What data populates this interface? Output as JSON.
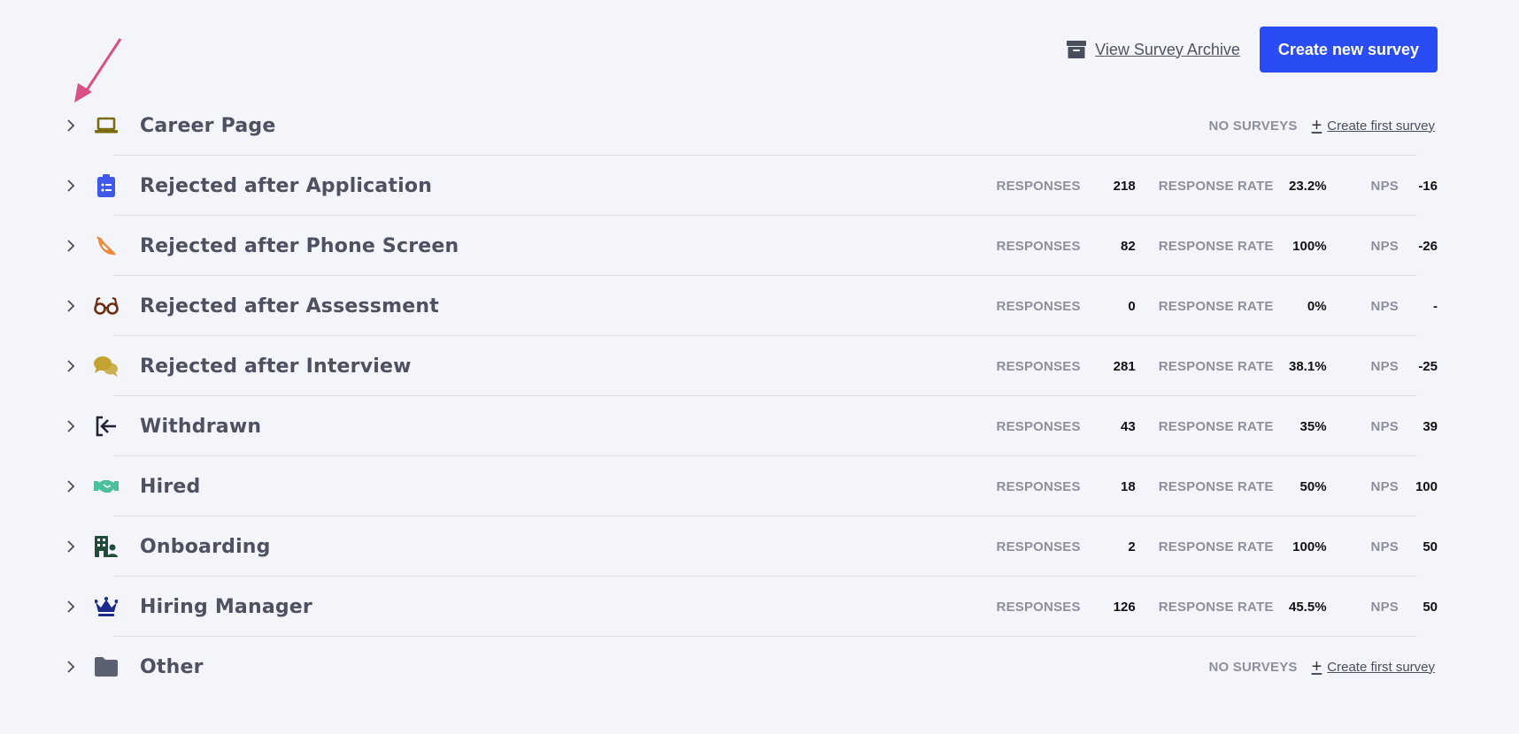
{
  "header": {
    "archive_label": "View Survey Archive",
    "create_label": "Create new survey"
  },
  "labels": {
    "responses": "RESPONSES",
    "response_rate": "RESPONSE RATE",
    "nps": "NPS",
    "no_surveys": "NO SURVEYS",
    "create_first": "Create first survey"
  },
  "colors": {
    "accent": "#2a4cf5",
    "annotation_arrow": "#d94f86"
  },
  "categories": [
    {
      "title": "Career Page",
      "icon": "laptop-icon",
      "icon_color": "#7a6a10",
      "has_surveys": false
    },
    {
      "title": "Rejected after Application",
      "icon": "clipboard-list-icon",
      "icon_color": "#3f5ae8",
      "has_surveys": true,
      "responses": "218",
      "response_rate": "23.2%",
      "nps": "-16"
    },
    {
      "title": "Rejected after Phone Screen",
      "icon": "phone-slash-icon",
      "icon_color": "#ee8a3e",
      "has_surveys": true,
      "responses": "82",
      "response_rate": "100%",
      "nps": "-26"
    },
    {
      "title": "Rejected after Assessment",
      "icon": "glasses-icon",
      "icon_color": "#6b2d12",
      "has_surveys": true,
      "responses": "0",
      "response_rate": "0%",
      "nps": "-"
    },
    {
      "title": "Rejected after Interview",
      "icon": "comments-icon",
      "icon_color": "#c2a332",
      "has_surveys": true,
      "responses": "281",
      "response_rate": "38.1%",
      "nps": "-25"
    },
    {
      "title": "Withdrawn",
      "icon": "sign-out-icon",
      "icon_color": "#1f2333",
      "has_surveys": true,
      "responses": "43",
      "response_rate": "35%",
      "nps": "39"
    },
    {
      "title": "Hired",
      "icon": "handshake-icon",
      "icon_color": "#4bbf9c",
      "has_surveys": true,
      "responses": "18",
      "response_rate": "50%",
      "nps": "100"
    },
    {
      "title": "Onboarding",
      "icon": "building-user-icon",
      "icon_color": "#1f4d3a",
      "has_surveys": true,
      "responses": "2",
      "response_rate": "100%",
      "nps": "50"
    },
    {
      "title": "Hiring Manager",
      "icon": "crown-icon",
      "icon_color": "#1c2a8c",
      "has_surveys": true,
      "responses": "126",
      "response_rate": "45.5%",
      "nps": "50"
    },
    {
      "title": "Other",
      "icon": "folder-icon",
      "icon_color": "#5b6170",
      "has_surveys": false
    }
  ]
}
